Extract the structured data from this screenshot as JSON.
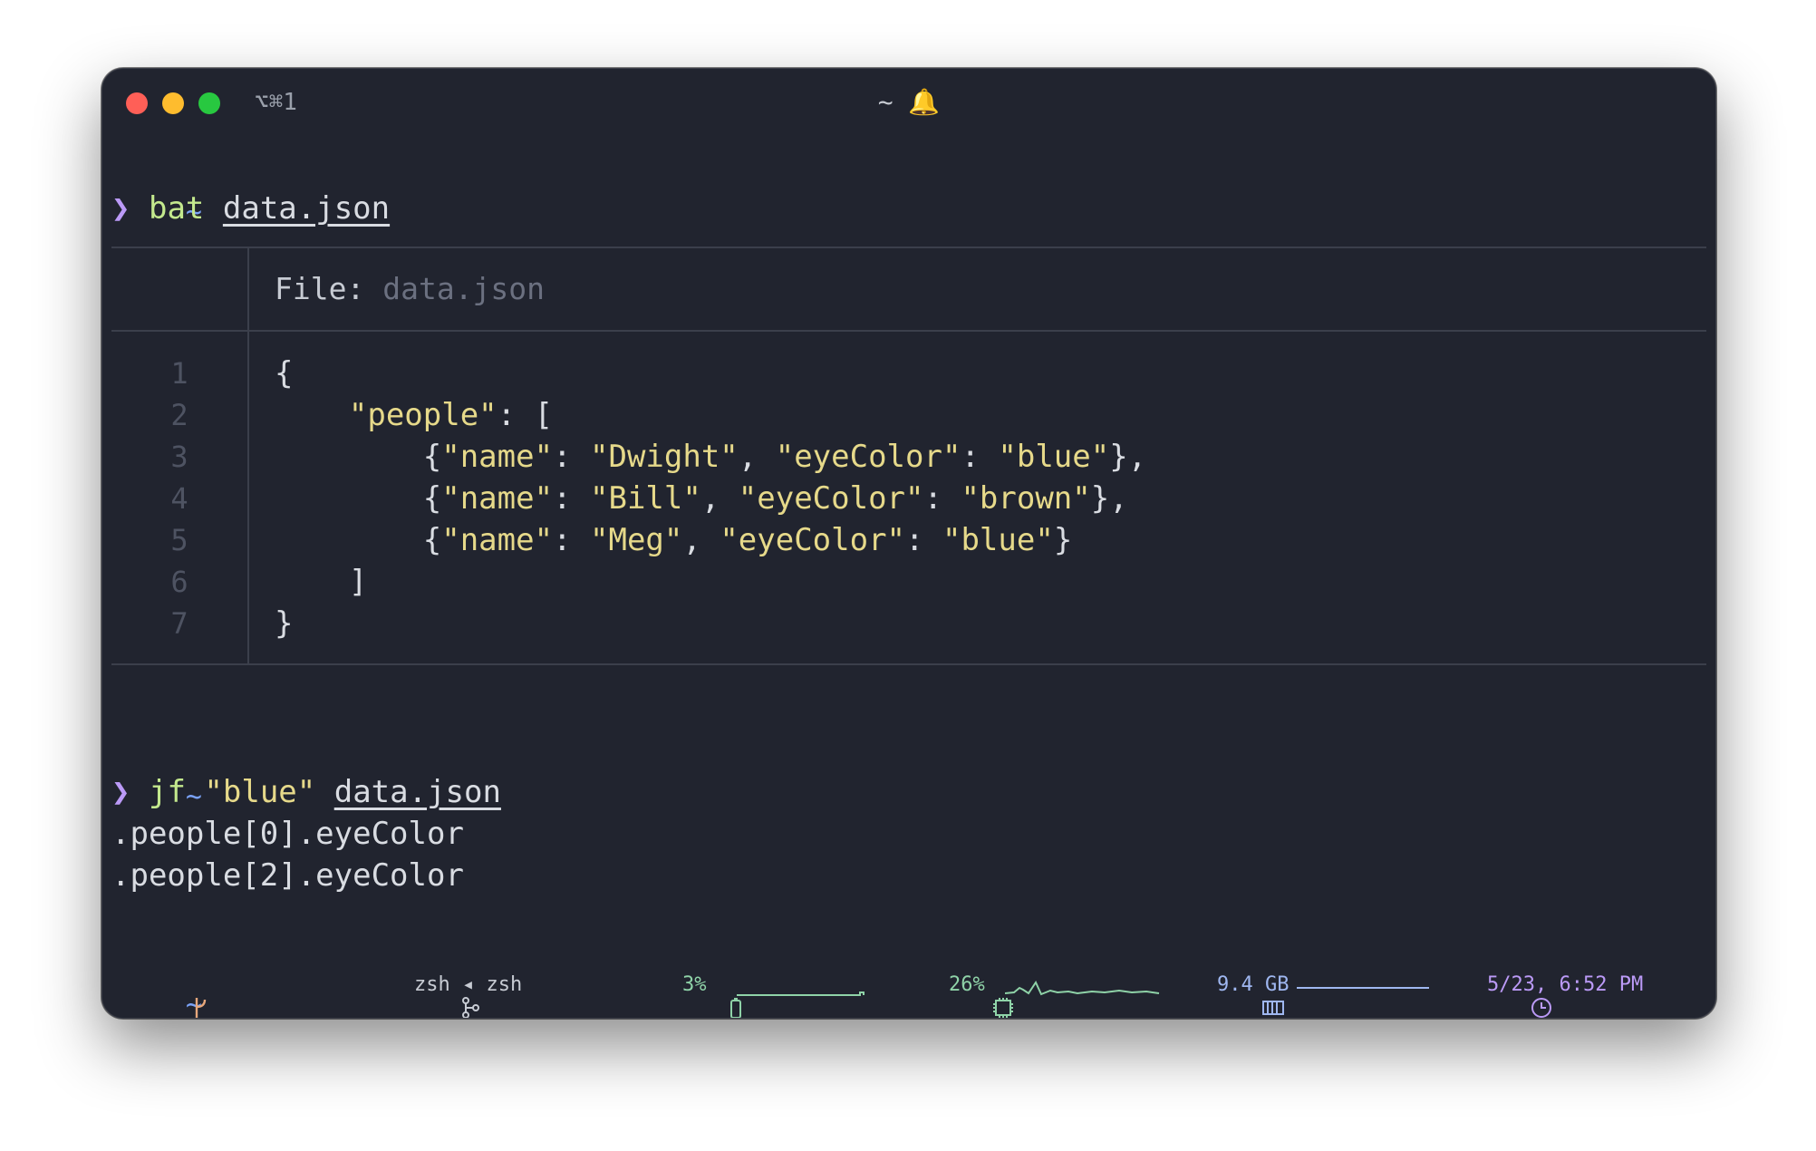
{
  "window": {
    "shortcut": "⌥⌘1",
    "title": "~ 🔔"
  },
  "session1": {
    "cwd": "~",
    "prompt": "❯",
    "command": "bat",
    "arg": "data.json"
  },
  "bat": {
    "file_label": "File:",
    "file_name": "data.json",
    "line_numbers": [
      "1",
      "2",
      "3",
      "4",
      "5",
      "6",
      "7"
    ]
  },
  "json_lines": {
    "l1": "{",
    "l2_key": "\"people\"",
    "l2_rest": ": [",
    "l3": {
      "key1": "\"name\"",
      "val1": "\"Dwight\"",
      "key2": "\"eyeColor\"",
      "val2": "\"blue\"",
      "tail": "},"
    },
    "l4": {
      "key1": "\"name\"",
      "val1": "\"Bill\"",
      "key2": "\"eyeColor\"",
      "val2": "\"brown\"",
      "tail": "},"
    },
    "l5": {
      "key1": "\"name\"",
      "val1": "\"Meg\"",
      "key2": "\"eyeColor\"",
      "val2": "\"blue\"",
      "tail": "}"
    },
    "l6": "]",
    "l7": "}"
  },
  "session2": {
    "cwd": "~",
    "prompt": "❯",
    "command": "jf",
    "query": "\"blue\"",
    "arg": "data.json",
    "output": [
      ".people[0].eyeColor",
      ".people[2].eyeColor"
    ]
  },
  "session3": {
    "cwd": "~"
  },
  "statusbar": {
    "git_icon": "git-branch-icon",
    "process": "zsh ◂ zsh",
    "battery": "3%",
    "cpu": "26%",
    "memory": "9.4 GB",
    "clock": "5/23, 6:52 PM"
  },
  "colors": {
    "background": "#21242f",
    "prompt": "#bb9af7",
    "command": "#c3e88d",
    "string": "#e6d98a",
    "statusbar_green": "#8fd3a8",
    "statusbar_purple": "#bb9af7"
  }
}
